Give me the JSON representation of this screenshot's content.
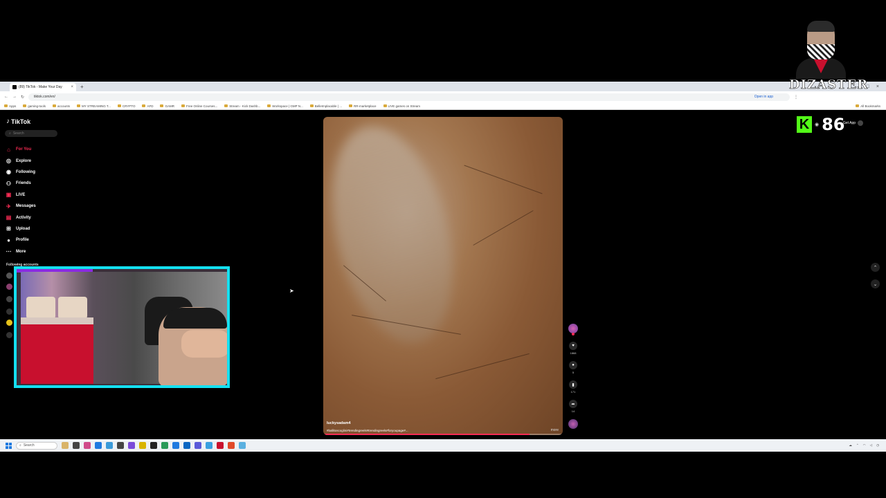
{
  "browser": {
    "tab_title": "(89) TikTok - Make Your Day",
    "url": "tiktok.com/en/",
    "open_in_app": "Open in app",
    "bookmarks": [
      "Apps",
      "gaming-tools",
      "accounts",
      "MY STREAMING T...",
      "CRYPTO",
      "AFD",
      "GAMR",
      "Free Online Courses...",
      "Stream - Kick Dashb...",
      "Workspace | GMP N...",
      "BelleImplacable | ...",
      "RR-marketplace",
      "LIVE games on Stream"
    ],
    "all_bookmarks": "All Bookmarks"
  },
  "sidebar": {
    "logo_text": "TikTok",
    "search_placeholder": "Search",
    "nav": [
      {
        "label": "For You",
        "icon": "home-icon"
      },
      {
        "label": "Explore",
        "icon": "compass-icon"
      },
      {
        "label": "Following",
        "icon": "following-icon"
      },
      {
        "label": "Friends",
        "icon": "friends-icon"
      },
      {
        "label": "LIVE",
        "icon": "live-icon"
      },
      {
        "label": "Messages",
        "icon": "messages-icon"
      },
      {
        "label": "Activity",
        "icon": "activity-icon"
      },
      {
        "label": "Upload",
        "icon": "upload-icon"
      },
      {
        "label": "Profile",
        "icon": "profile-icon"
      },
      {
        "label": "More",
        "icon": "more-icon"
      }
    ],
    "following_accounts": "Following accounts"
  },
  "video": {
    "username": "luckysadam4",
    "tags": "#ballitoscoglini#trendingreels#trendingreels#foryoupage#...",
    "more": "more",
    "progress": 0.86
  },
  "actions": {
    "likes": "1868",
    "comments": "5",
    "saves": "171",
    "shares": "14"
  },
  "topright": {
    "get_app": "Get App"
  },
  "overlay": {
    "kick_logo": "K",
    "viewer_count": "86",
    "streamer_name": "DIZASTER"
  },
  "taskbar": {
    "search": "Search"
  },
  "colors": {
    "tiktok_red": "#fe2c55",
    "kick_green": "#53fc18",
    "webcam_border": "#14e0f0"
  }
}
